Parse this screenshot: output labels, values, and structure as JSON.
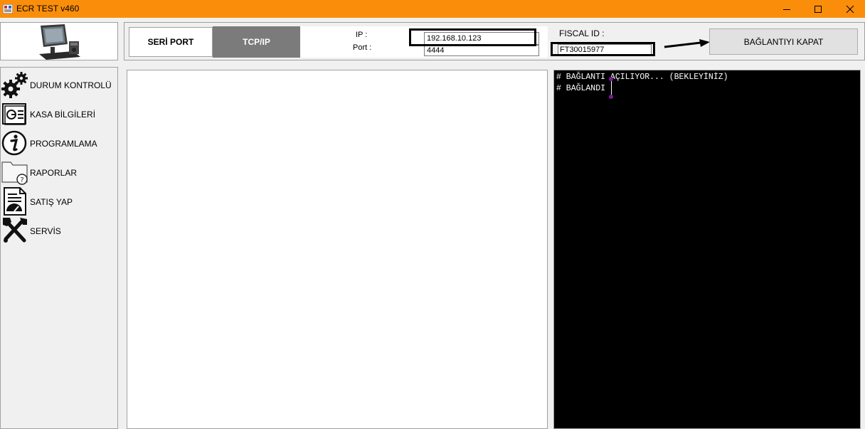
{
  "window": {
    "title": "ECR TEST v460",
    "title_bar_color": "#fa8e0a",
    "controls": [
      "minimize-icon",
      "maximize-icon",
      "close-icon"
    ]
  },
  "connection": {
    "tab_serial_label": "SERİ PORT",
    "tab_tcp_label": "TCP/IP",
    "active_tab": "TCP/IP",
    "ip_label": "IP :",
    "ip_value": "192.168.10.123",
    "port_label": "Port :",
    "port_value": "4444",
    "fiscal_label": "FISCAL ID :",
    "fiscal_value": "FT30015977",
    "close_button_label": "BAĞLANTIYI KAPAT"
  },
  "sidebar": {
    "items": [
      {
        "label": "DURUM KONTROLÜ",
        "icon": "gears-icon"
      },
      {
        "label": "KASA BİLGİLERİ",
        "icon": "register-info-icon"
      },
      {
        "label": "PROGRAMLAMA",
        "icon": "info-icon"
      },
      {
        "label": "RAPORLAR",
        "icon": "folder-question-icon"
      },
      {
        "label": "SATIŞ YAP",
        "icon": "sale-document-icon"
      },
      {
        "label": "SERVİS",
        "icon": "tools-icon"
      }
    ]
  },
  "console": {
    "lines": [
      "# BAĞLANTI AÇILIYOR... (BEKLEYİNİZ)",
      "# BAĞLANDI"
    ],
    "background": "#000000",
    "text_color": "#ffffff"
  }
}
